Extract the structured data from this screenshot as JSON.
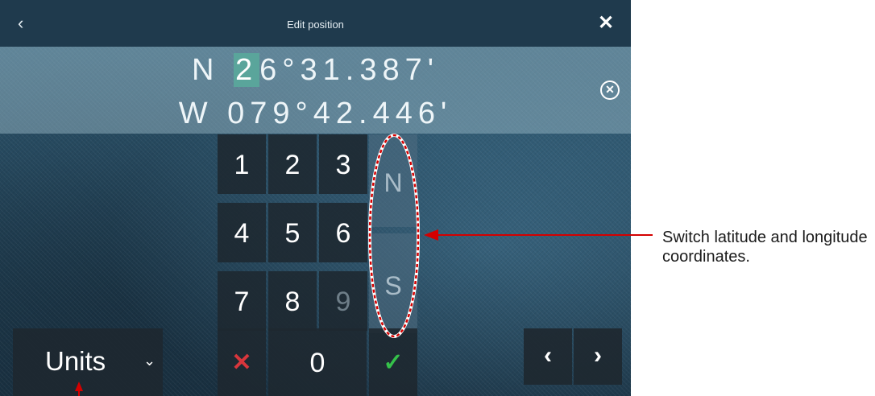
{
  "window": {
    "title": "Edit position"
  },
  "icons": {
    "back": "chevron-left-icon",
    "close": "close-icon",
    "clear": "clear-circle-icon",
    "units_dropdown": "chevron-down-icon",
    "cancel": "cross-icon",
    "confirm": "check-icon",
    "prev": "chevron-left-icon",
    "next": "chevron-right-icon"
  },
  "glyphs": {
    "back": "‹",
    "close": "✕",
    "clear": "✕",
    "chevron_down": "⌄",
    "cancel": "✕",
    "confirm": "✓",
    "prev": "‹",
    "next": "›"
  },
  "position": {
    "lat_hemisphere": "N",
    "lat_cursor_digit": "2",
    "lat_rest": "6°31.387'",
    "longitude": "W 079°42.446'"
  },
  "keypad": {
    "keys": [
      "1",
      "2",
      "3",
      "4",
      "5",
      "6",
      "7",
      "8",
      "9"
    ],
    "disabled_keys": [
      "9"
    ],
    "hemisphere_north": "N",
    "hemisphere_south": "S",
    "zero": "0"
  },
  "units": {
    "label": "Units"
  },
  "annotation": {
    "callout_text": "Switch latitude and longitude coordinates."
  },
  "colors": {
    "titlebar": "#1f3a4d",
    "cursor_highlight": "#5aa59b",
    "cancel_red": "#d8363c",
    "confirm_green": "#35c14a",
    "annotation_red": "#d40000"
  }
}
